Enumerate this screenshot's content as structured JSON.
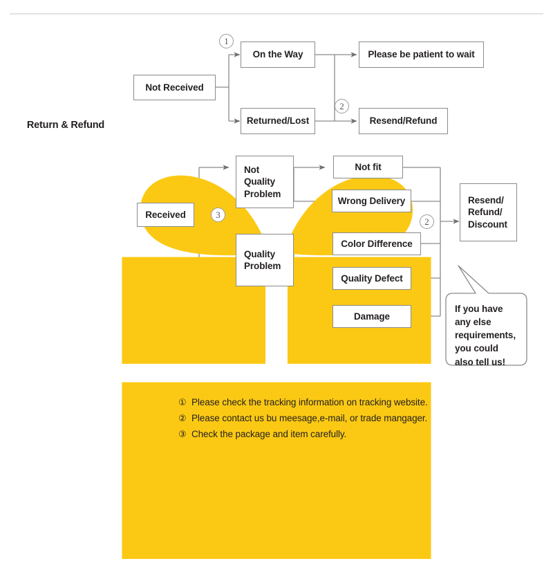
{
  "brand": {
    "icon": "gift-box-icon",
    "label": "Return & Refund",
    "icon_color": "#FBC914"
  },
  "colors": {
    "line": "#8a8a8a",
    "arrow": "#6d6e71",
    "text": "#231f20",
    "marker": "#9a9a9a",
    "rule": "#d8d8d8"
  },
  "flow": {
    "not_received": {
      "root": "Not Received",
      "branch_on_the_way": "On the Way",
      "branch_returned_lost": "Returned/Lost",
      "outcome_wait": "Please be patient to wait",
      "outcome_resend_refund": "Resend/Refund",
      "marker_on_the_way": "1",
      "marker_resend": "2"
    },
    "received": {
      "root": "Received",
      "marker_root": "3",
      "not_quality": "Not\nQuality\nProblem",
      "quality": "Quality\nProblem",
      "reasons_not_quality": [
        "Not fit",
        "Wrong Delivery"
      ],
      "reasons_quality": [
        "Color Difference",
        "Quality Defect",
        "Damage"
      ],
      "outcome": "Resend/\nRefund/\nDiscount",
      "marker_outcome": "2"
    }
  },
  "bubble": {
    "text": "If you have\nany else\nrequirements,\nyou could\nalso tell us!"
  },
  "notes": [
    {
      "num": "①",
      "text": "Please check the tracking information on tracking website."
    },
    {
      "num": "②",
      "text": "Please contact us bu meesage,e-mail, or trade mangager."
    },
    {
      "num": "③",
      "text": "Check the package and item carefully."
    }
  ]
}
